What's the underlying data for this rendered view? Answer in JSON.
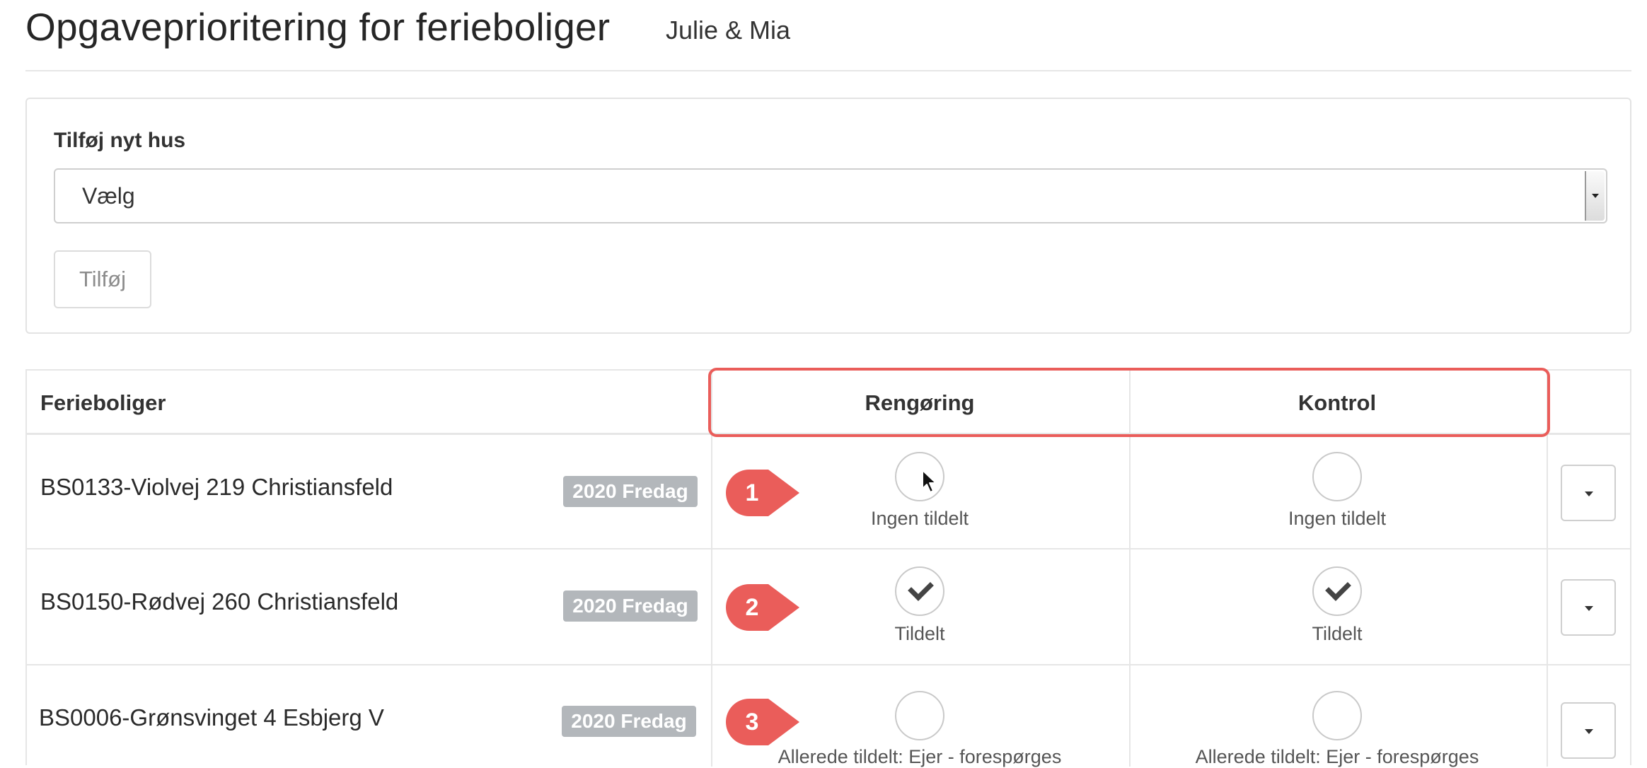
{
  "page": {
    "title": "Opgaveprioritering for ferieboliger",
    "subtitle": "Julie & Mia"
  },
  "add_house": {
    "label": "Tilføj nyt hus",
    "select_value": "Vælg",
    "button_label": "Tilføj"
  },
  "table": {
    "columns": [
      "Ferieboliger",
      "Rengøring",
      "Kontrol"
    ],
    "rows": [
      {
        "house": "BS0133-Violvej 219 Christiansfeld",
        "badge": "2020 Fredag",
        "marker": "1",
        "cleaning": {
          "checked": false,
          "status": "Ingen tildelt"
        },
        "control": {
          "checked": false,
          "status": "Ingen tildelt"
        }
      },
      {
        "house": "BS0150-Rødvej 260 Christiansfeld",
        "badge": "2020 Fredag",
        "marker": "2",
        "cleaning": {
          "checked": true,
          "status": "Tildelt"
        },
        "control": {
          "checked": true,
          "status": "Tildelt"
        }
      },
      {
        "house": "BS0006-Grønsvinget 4 Esbjerg V",
        "badge": "2020 Fredag",
        "marker": "3",
        "cleaning": {
          "checked": false,
          "status": "Allerede tildelt: Ejer - forespørges"
        },
        "control": {
          "checked": false,
          "status": "Allerede tildelt: Ejer - forespørges"
        }
      }
    ]
  },
  "colors": {
    "highlight": "#ea5d5a",
    "badge": "#b3b7bb"
  }
}
